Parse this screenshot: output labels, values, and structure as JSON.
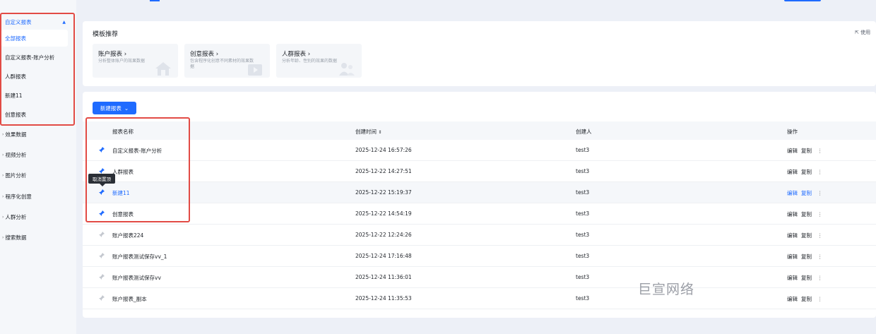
{
  "sidebar": {
    "group_title": "自定义报表",
    "sub_items": [
      "全部报表",
      "自定义报表-账户分析",
      "人群报表",
      "新建11",
      "创意报表"
    ],
    "items": [
      "效果数据",
      "视频分析",
      "图片分析",
      "程序化创意",
      "人群分析",
      "搜索数据"
    ]
  },
  "templates": {
    "title": "模板推荐",
    "link": "使用",
    "cards": [
      {
        "name": "账户报表",
        "desc": "分析整体账户的效果数据"
      },
      {
        "name": "创意报表",
        "desc": "包含程序化创意不同素材的效果数据"
      },
      {
        "name": "人群报表",
        "desc": "分析年龄、性别的效果的数据"
      }
    ]
  },
  "toolbar": {
    "new_report": "新建报表"
  },
  "table": {
    "headers": {
      "name": "报表名称",
      "created": "创建时间",
      "creator": "创建人",
      "ops": "操作"
    },
    "rows": [
      {
        "name": "自定义报表-账户分析",
        "created": "2025-12-24 16:57:26",
        "creator": "test3",
        "pinned": true
      },
      {
        "name": "人群报表",
        "created": "2025-12-22 14:27:51",
        "creator": "test3",
        "pinned": true
      },
      {
        "name": "新建11",
        "created": "2025-12-22 15:19:37",
        "creator": "test3",
        "pinned": true
      },
      {
        "name": "创意报表",
        "created": "2025-12-22 14:54:19",
        "creator": "test3",
        "pinned": true
      },
      {
        "name": "账户报表224",
        "created": "2025-12-22 12:24:26",
        "creator": "test3",
        "pinned": false
      },
      {
        "name": "账户报表测试保存vv_1",
        "created": "2025-12-24 17:16:48",
        "creator": "test3",
        "pinned": false
      },
      {
        "name": "账户报表测试保存vv",
        "created": "2025-12-24 11:36:01",
        "creator": "test3",
        "pinned": false
      },
      {
        "name": "账户报表_副本",
        "created": "2025-12-24 11:35:53",
        "creator": "test3",
        "pinned": false
      }
    ],
    "ops": {
      "edit": "编辑",
      "copy": "复制",
      "more": "⋮"
    }
  },
  "tooltip": "取消置顶",
  "watermark": "巨宣网络",
  "colors": {
    "accent": "#1f6bff",
    "highlight": "#e24b45"
  }
}
